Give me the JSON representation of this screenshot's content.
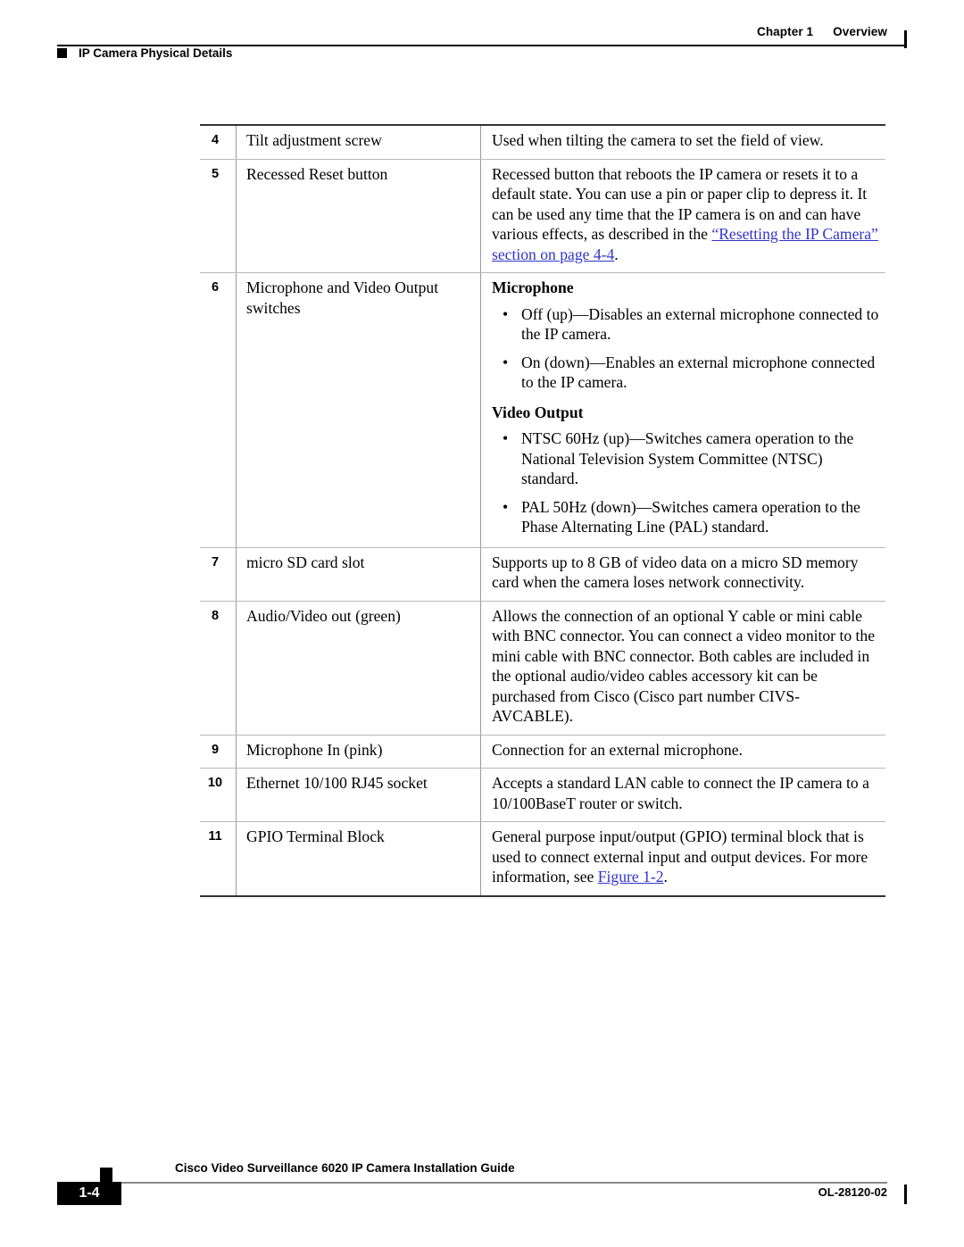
{
  "header": {
    "chapter": "Chapter 1",
    "chapter_title": "Overview",
    "section_label": "IP Camera Physical Details"
  },
  "footer": {
    "guide_title": "Cisco Video Surveillance 6020 IP Camera Installation Guide",
    "page_number": "1-4",
    "doc_id": "OL-28120-02"
  },
  "colors": {
    "xref_link": "#3333CC",
    "rule": "#000000",
    "row_separator": "#B8B8B8"
  },
  "table": {
    "rows": [
      {
        "num": "4",
        "name": "Tilt adjustment screw",
        "desc": "Used when tilting the camera to set the field of view."
      },
      {
        "num": "5",
        "name": "Recessed Reset button",
        "desc_pre": "Recessed button that reboots the IP camera or resets it to a default state. You can use a pin or paper clip to depress it. It can be used any time that the IP camera is on and can have various effects, as described in the ",
        "desc_link": "“Resetting the IP Camera” section on page 4-4",
        "desc_post": "."
      },
      {
        "num": "6",
        "name": "Microphone and Video Output switches",
        "subhead_1": "Microphone",
        "bullets_1": [
          "Off (up)—Disables an external microphone connected to the IP camera.",
          "On (down)—Enables an external microphone connected to the IP camera."
        ],
        "subhead_2": "Video Output",
        "bullets_2": [
          "NTSC 60Hz (up)—Switches camera operation to the National Television System Committee (NTSC) standard.",
          "PAL 50Hz (down)—Switches camera operation to the Phase Alternating Line (PAL) standard."
        ]
      },
      {
        "num": "7",
        "name": "micro SD card slot",
        "desc": "Supports up to 8 GB of video data on a micro SD memory card when the camera loses network connectivity."
      },
      {
        "num": "8",
        "name": "Audio/Video out (green)",
        "desc": "Allows the connection of an optional Y cable or mini cable with BNC connector. You can connect a video monitor to the mini cable with BNC connector. Both cables are included in the optional audio/video cables accessory kit can be purchased from Cisco (Cisco part number CIVS-AVCABLE)."
      },
      {
        "num": "9",
        "name": "Microphone In (pink)",
        "desc": "Connection for an external microphone."
      },
      {
        "num": "10",
        "name": "Ethernet 10/100 RJ45 socket",
        "desc": "Accepts a standard LAN cable to connect the IP camera to a 10/100BaseT router or switch."
      },
      {
        "num": "11",
        "name": "GPIO Terminal Block",
        "desc_pre": "General purpose input/output (GPIO) terminal block that is used to connect external input and output devices. For more information, see ",
        "desc_link": "Figure 1-2",
        "desc_post": "."
      }
    ]
  },
  "glyphs": {
    "bullet": "•"
  }
}
